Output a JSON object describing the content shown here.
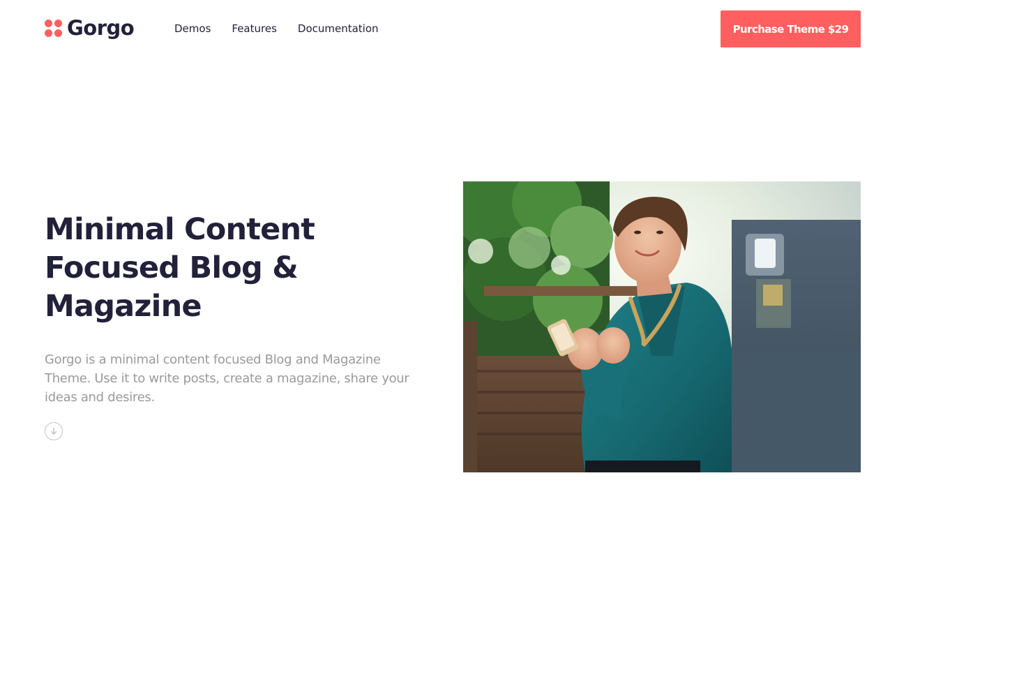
{
  "brand": {
    "name": "Gorgo",
    "logo_icon": "four-dots-logo-icon",
    "accent_color": "#ff5f5f",
    "text_color": "#22213a",
    "muted_color": "#9a9a9a"
  },
  "nav": {
    "items": [
      {
        "label": "Demos"
      },
      {
        "label": "Features"
      },
      {
        "label": "Documentation"
      }
    ]
  },
  "header": {
    "cta_label": "Purchase Theme $29"
  },
  "hero": {
    "title": "Minimal Content Focused Blog & Magazine",
    "description": "Gorgo is a minimal content focused Blog and Magazine Theme. Use it to write posts, create a magazine, share your ideas and desires.",
    "scroll_icon": "arrow-down-circle-icon",
    "image_subject": "woman-holding-phone-photo"
  }
}
